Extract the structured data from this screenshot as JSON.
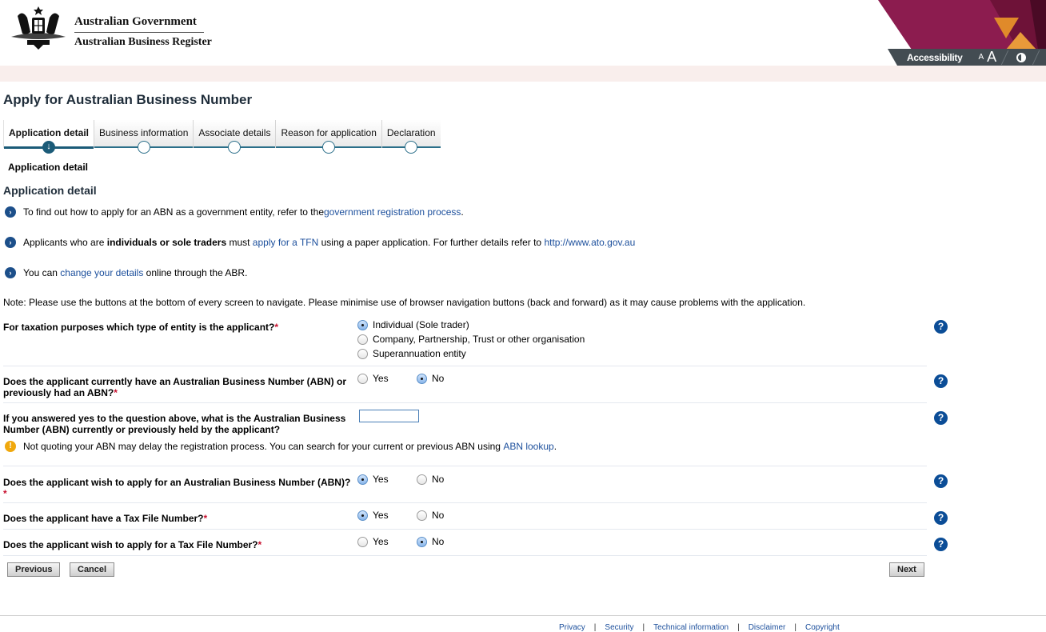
{
  "header": {
    "gov_name": "Australian Government",
    "register_name": "Australian Business Register",
    "accessibility_label": "Accessibility",
    "font_small": "A",
    "font_large": "A",
    "colors": {
      "brand_magenta": "#8c1c4f",
      "accent_orange": "#e08a2a",
      "bar": "#434c52",
      "band": "#f9eeec"
    }
  },
  "page_title": "Apply for Australian Business Number",
  "stepper": {
    "steps": [
      {
        "label": "Application detail",
        "active": true
      },
      {
        "label": "Business information",
        "active": false
      },
      {
        "label": "Associate details",
        "active": false
      },
      {
        "label": "Reason for application",
        "active": false
      },
      {
        "label": "Declaration",
        "active": false
      }
    ],
    "active_icon": "↓"
  },
  "sub_title": "Application detail",
  "section_title": "Application detail",
  "info": [
    {
      "pre": "To find out how to apply for an ABN as a government entity, refer to the ",
      "link": "government registration process",
      "post": "."
    },
    {
      "pre": "Applicants who are ",
      "bold": "individuals or sole traders",
      "mid": " must ",
      "link": "apply for a TFN",
      "post": " using a paper application. For further details refer to ",
      "link2": "http://www.ato.gov.au"
    },
    {
      "pre": "You can ",
      "link": "change your details",
      "post": " online through the ABR."
    }
  ],
  "note": "Note: Please use the buttons at the bottom of every screen to navigate. Please minimise use of browser navigation buttons (back and forward) as it may cause problems with the application.",
  "questions": {
    "entity_type": {
      "label": "For taxation purposes which type of entity is the applicant?",
      "required": "*",
      "options": [
        "Individual (Sole trader)",
        "Company, Partnership, Trust or other organisation",
        "Superannuation entity"
      ],
      "selected": "Individual (Sole trader)"
    },
    "has_abn": {
      "label_line1": "Does the applicant currently have an Australian Business Number (ABN) or",
      "label_line2": "previously had an ABN?",
      "required": "*",
      "options": [
        "Yes",
        "No"
      ],
      "selected": "No"
    },
    "abn_number": {
      "label_line1": "If you answered yes to the question above, what is the Australian Business",
      "label_line2": "Number (ABN) currently or previously held by the applicant?",
      "value": "",
      "warning_pre": "Not quoting your ABN may delay the registration process. You can search for your current or previous ABN using ",
      "warning_link": "ABN lookup",
      "warning_post": "."
    },
    "apply_abn": {
      "label": "Does the applicant wish to apply for an Australian Business Number (ABN)?",
      "required": "*",
      "options": [
        "Yes",
        "No"
      ],
      "selected": "Yes"
    },
    "has_tfn": {
      "label": "Does the applicant have a Tax File Number?",
      "required": "*",
      "options": [
        "Yes",
        "No"
      ],
      "selected": "Yes"
    },
    "apply_tfn": {
      "label": "Does the applicant wish to apply for a Tax File Number?",
      "required": "*",
      "options": [
        "Yes",
        "No"
      ],
      "selected": "No"
    }
  },
  "help_icon": "?",
  "buttons": {
    "previous": "Previous",
    "cancel": "Cancel",
    "next": "Next"
  },
  "footer": {
    "links": [
      "Privacy",
      "Security",
      "Technical information",
      "Disclaimer",
      "Copyright"
    ],
    "separator": "|"
  }
}
